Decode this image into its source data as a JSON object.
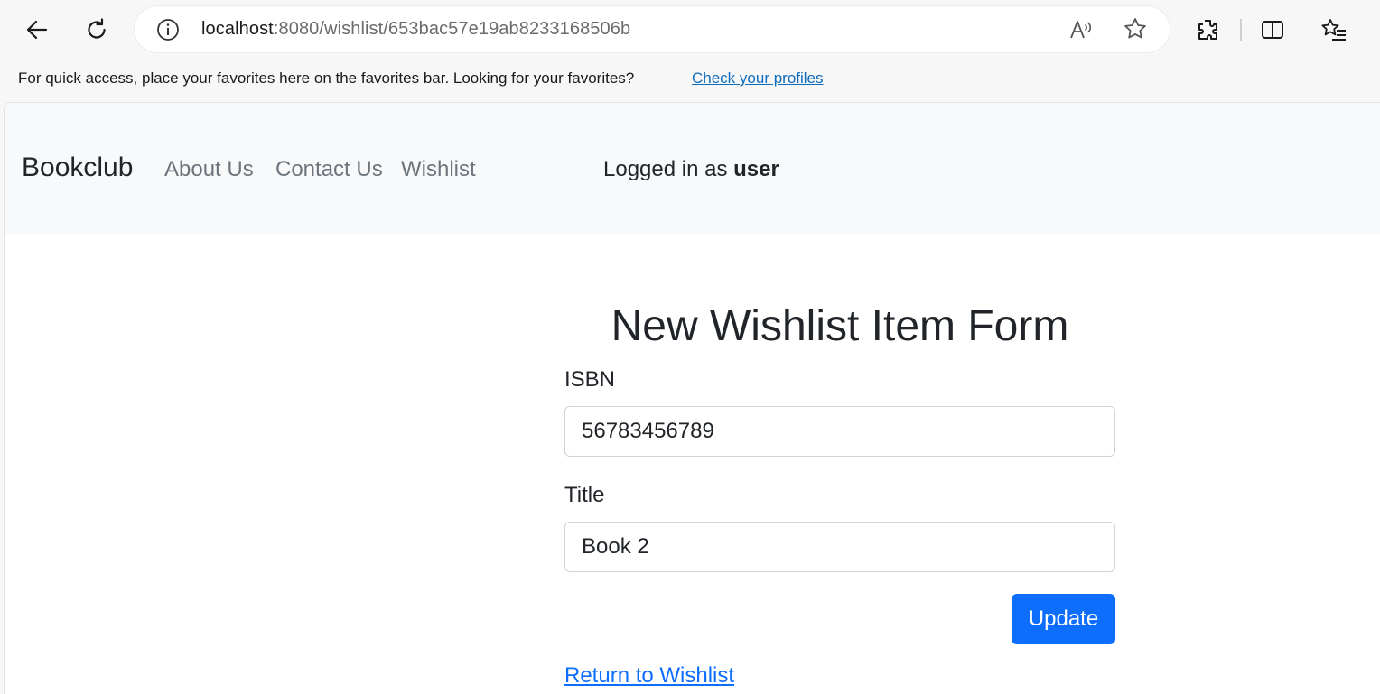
{
  "browser": {
    "url_host": "localhost",
    "url_path": ":8080/wishlist/653bac57e19ab8233168506b",
    "icons": [
      "back-arrow-icon",
      "refresh-icon",
      "info-icon",
      "read-aloud-icon",
      "favorite-star-icon",
      "extensions-icon",
      "split-screen-icon",
      "favorites-icon"
    ]
  },
  "favorites_bar": {
    "message": "For quick access, place your favorites here on the favorites bar. Looking for your favorites?",
    "link": "Check your profiles"
  },
  "navbar": {
    "brand": "Bookclub",
    "links": [
      "About Us",
      "Contact Us",
      "Wishlist"
    ],
    "logged_in_prefix": "Logged in as",
    "username": "user"
  },
  "form": {
    "title": "New Wishlist Item Form",
    "isbn_label": "ISBN",
    "isbn_value": "56783456789",
    "title_label": "Title",
    "title_value": "Book 2",
    "submit_label": "Update",
    "return_link": "Return to Wishlist"
  },
  "colors": {
    "primary": "#0d6efd",
    "navbar_bg": "#f8f9fa",
    "link_muted": "#6c757d",
    "edge_link": "#0f6cbd"
  }
}
